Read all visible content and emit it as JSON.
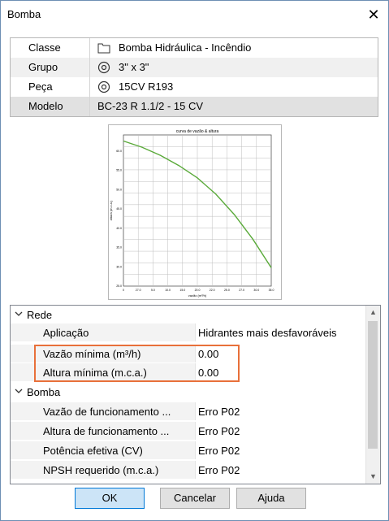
{
  "window": {
    "title": "Bomba"
  },
  "info": {
    "rows": [
      {
        "label": "Classe",
        "value": "Bomba Hidráulica - Incêndio",
        "icon": "folder-icon"
      },
      {
        "label": "Grupo",
        "value": "3\" x 3\"",
        "icon": "target-icon"
      },
      {
        "label": "Peça",
        "value": "15CV R193",
        "icon": "target-icon"
      },
      {
        "label": "Modelo",
        "value": "BC-23 R 1.1/2 - 15 CV",
        "icon": ""
      }
    ]
  },
  "chart": {
    "title": "curva de vazão & altura",
    "xlabel": "vazão (m³/h)",
    "ylabel": "altura (m.c.a.)",
    "y_ticks": [
      "60.0",
      "55.0",
      "50.0",
      "45.0",
      "40.0",
      "35.0",
      "30.0",
      "25.0"
    ],
    "x_ticks": [
      "0",
      "27.0",
      "5.0",
      "10.0",
      "15.0",
      "20.0",
      "22.0",
      "25.0",
      "27.0",
      "30.0",
      "35.0"
    ],
    "line_color": "#5aaa3a"
  },
  "chart_data": {
    "type": "line",
    "title": "curva de vazão & altura",
    "xlabel": "vazão (m³/h)",
    "ylabel": "altura (m.c.a.)",
    "x": [
      0,
      5,
      10,
      15,
      20,
      25,
      30,
      35,
      40
    ],
    "series": [
      {
        "values": [
          60.5,
          59.0,
          57.0,
          54.5,
          51.5,
          47.5,
          42.5,
          36.5,
          29.5
        ]
      }
    ],
    "xlim": [
      0,
      40
    ],
    "ylim": [
      25,
      62
    ],
    "grid": true
  },
  "grid": {
    "categories": [
      {
        "label": "Rede",
        "props": [
          {
            "label": "Aplicação",
            "value": "Hidrantes mais desfavoráveis"
          },
          {
            "label": "Vazão mínima (m³/h)",
            "value": "0.00"
          },
          {
            "label": "Altura mínima (m.c.a.)",
            "value": "0.00"
          }
        ]
      },
      {
        "label": "Bomba",
        "props": [
          {
            "label": "Vazão de funcionamento ...",
            "value": "Erro P02"
          },
          {
            "label": "Altura de funcionamento ...",
            "value": "Erro P02"
          },
          {
            "label": "Potência efetiva (CV)",
            "value": "Erro P02"
          },
          {
            "label": "NPSH requerido (m.c.a.)",
            "value": "Erro P02"
          }
        ]
      }
    ]
  },
  "buttons": {
    "ok": "OK",
    "cancel": "Cancelar",
    "help": "Ajuda"
  }
}
